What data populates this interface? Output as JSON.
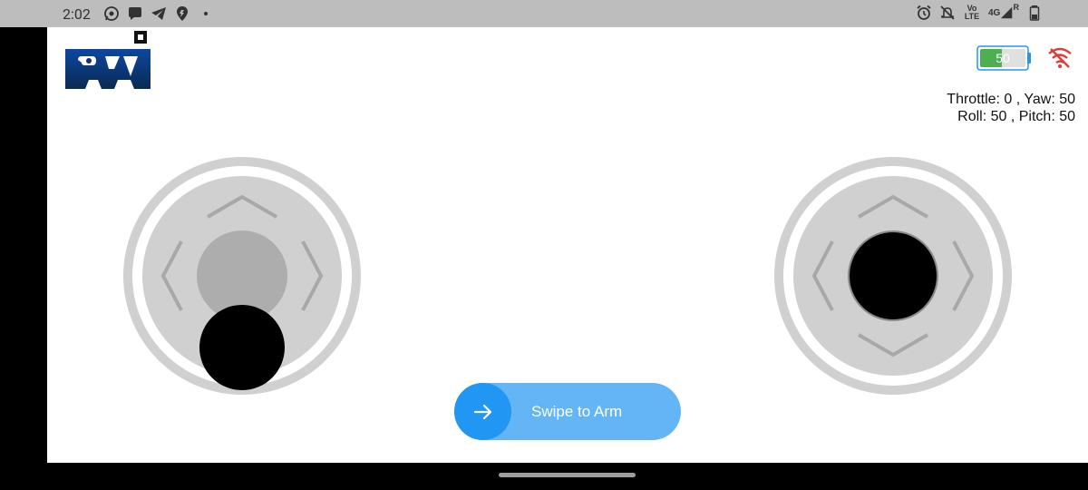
{
  "status_bar": {
    "time": "2:02",
    "left_icons": [
      "whatsapp-icon",
      "chat-bubble-icon",
      "telegram-icon",
      "location-icon",
      "dot-icon"
    ],
    "right_icons": [
      "alarm-icon",
      "mute-icon",
      "volte-icon",
      "signal-icon",
      "battery-icon"
    ],
    "volte_top": "Vo",
    "volte_bottom": "LTE",
    "network": "4G",
    "roaming": "R"
  },
  "app": {
    "logo_name": "pyi-logo",
    "battery_level": "50",
    "battery_fraction": 0.5,
    "battery_color": "#4caf50",
    "wifi_status": "disconnected",
    "wifi_color": "#e53935",
    "telemetry": {
      "line1": "Throttle: 0 , Yaw: 50",
      "line2": "Roll: 50 , Pitch: 50"
    },
    "left_joystick": {
      "x": 50,
      "y": 0
    },
    "right_joystick": {
      "x": 50,
      "y": 50
    },
    "swipe_label": "Swipe to Arm",
    "accent": "#2196f3",
    "accent_light": "#64b5f6"
  }
}
